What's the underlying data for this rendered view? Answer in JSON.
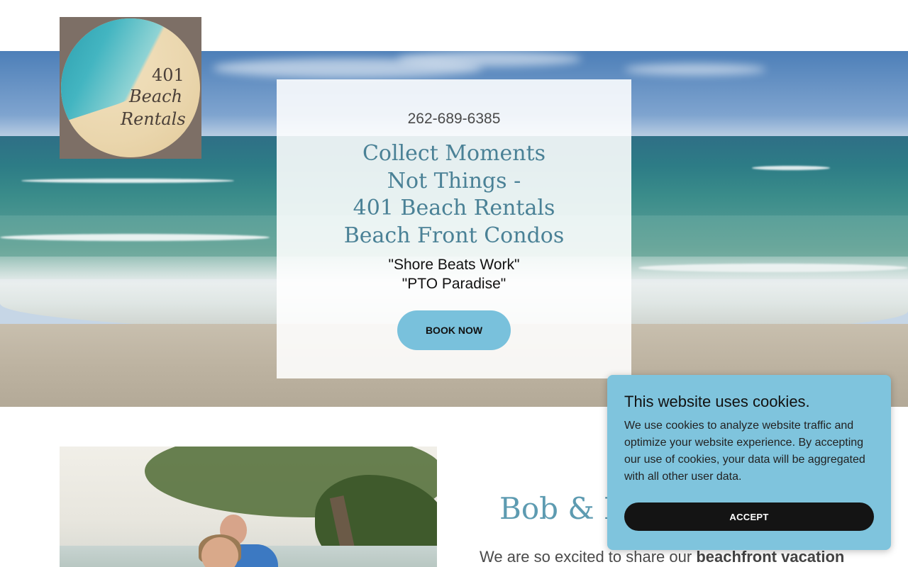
{
  "header": {
    "logo": {
      "number": "401",
      "line1": "Beach",
      "line2": "Rentals"
    }
  },
  "hero": {
    "phone": "262-689-6385",
    "headline": [
      "Collect Moments",
      "Not Things -",
      "401 Beach Rentals",
      "Beach Front Condos"
    ],
    "tagline": [
      "\"Shore Beats Work\"",
      "\"PTO Paradise\""
    ],
    "book_button": "BOOK NOW"
  },
  "about": {
    "title": "Bob & N",
    "text_prefix": "We are so excited to share our ",
    "text_bold": "beachfront vacation"
  },
  "cookie_banner": {
    "title": "This website uses cookies.",
    "body": "We use cookies to analyze website traffic and optimize your website experience. By accepting our use of cookies, your data will be aggregated with all other user data.",
    "accept_label": "ACCEPT"
  },
  "colors": {
    "headline": "#4a8196",
    "button_bg": "#79c1dc",
    "cookie_bg": "#7fc4dd",
    "accept_bg": "#141414",
    "about_title": "#5d9bb1"
  }
}
